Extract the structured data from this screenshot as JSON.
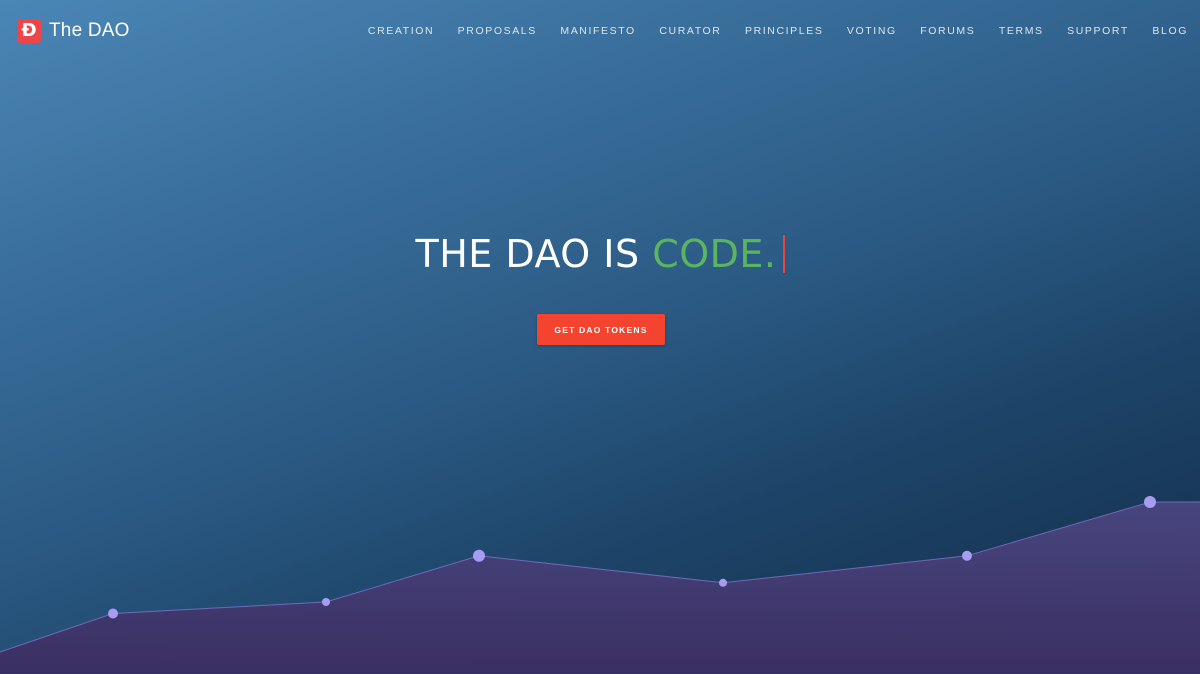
{
  "brand": {
    "logo_glyph": "Đ",
    "name": "The DAO",
    "logo_color": "#ef4549"
  },
  "nav": {
    "items": [
      {
        "label": "CREATION"
      },
      {
        "label": "PROPOSALS"
      },
      {
        "label": "MANIFESTO"
      },
      {
        "label": "CURATOR"
      },
      {
        "label": "PRINCIPLES"
      },
      {
        "label": "VOTING"
      },
      {
        "label": "FORUMS"
      },
      {
        "label": "TERMS"
      },
      {
        "label": "SUPPORT"
      },
      {
        "label": "BLOG"
      }
    ]
  },
  "hero": {
    "headline_prefix": "THE DAO IS ",
    "headline_accent": "CODE.",
    "accent_color": "#5bb560",
    "cta_label": "GET DAO TOKENS",
    "cta_color": "#f4432e"
  },
  "chart_data": {
    "type": "area",
    "fill_color": "#4a4680",
    "point_color": "#a89cf2",
    "x": [
      0,
      1,
      2,
      3,
      4,
      5,
      6,
      7
    ],
    "values": [
      0.5,
      1.5,
      1.8,
      3.0,
      2.3,
      3.0,
      4.4,
      4.4
    ],
    "marker_sizes": [
      0,
      5,
      4,
      6,
      4,
      5,
      6,
      0
    ]
  }
}
